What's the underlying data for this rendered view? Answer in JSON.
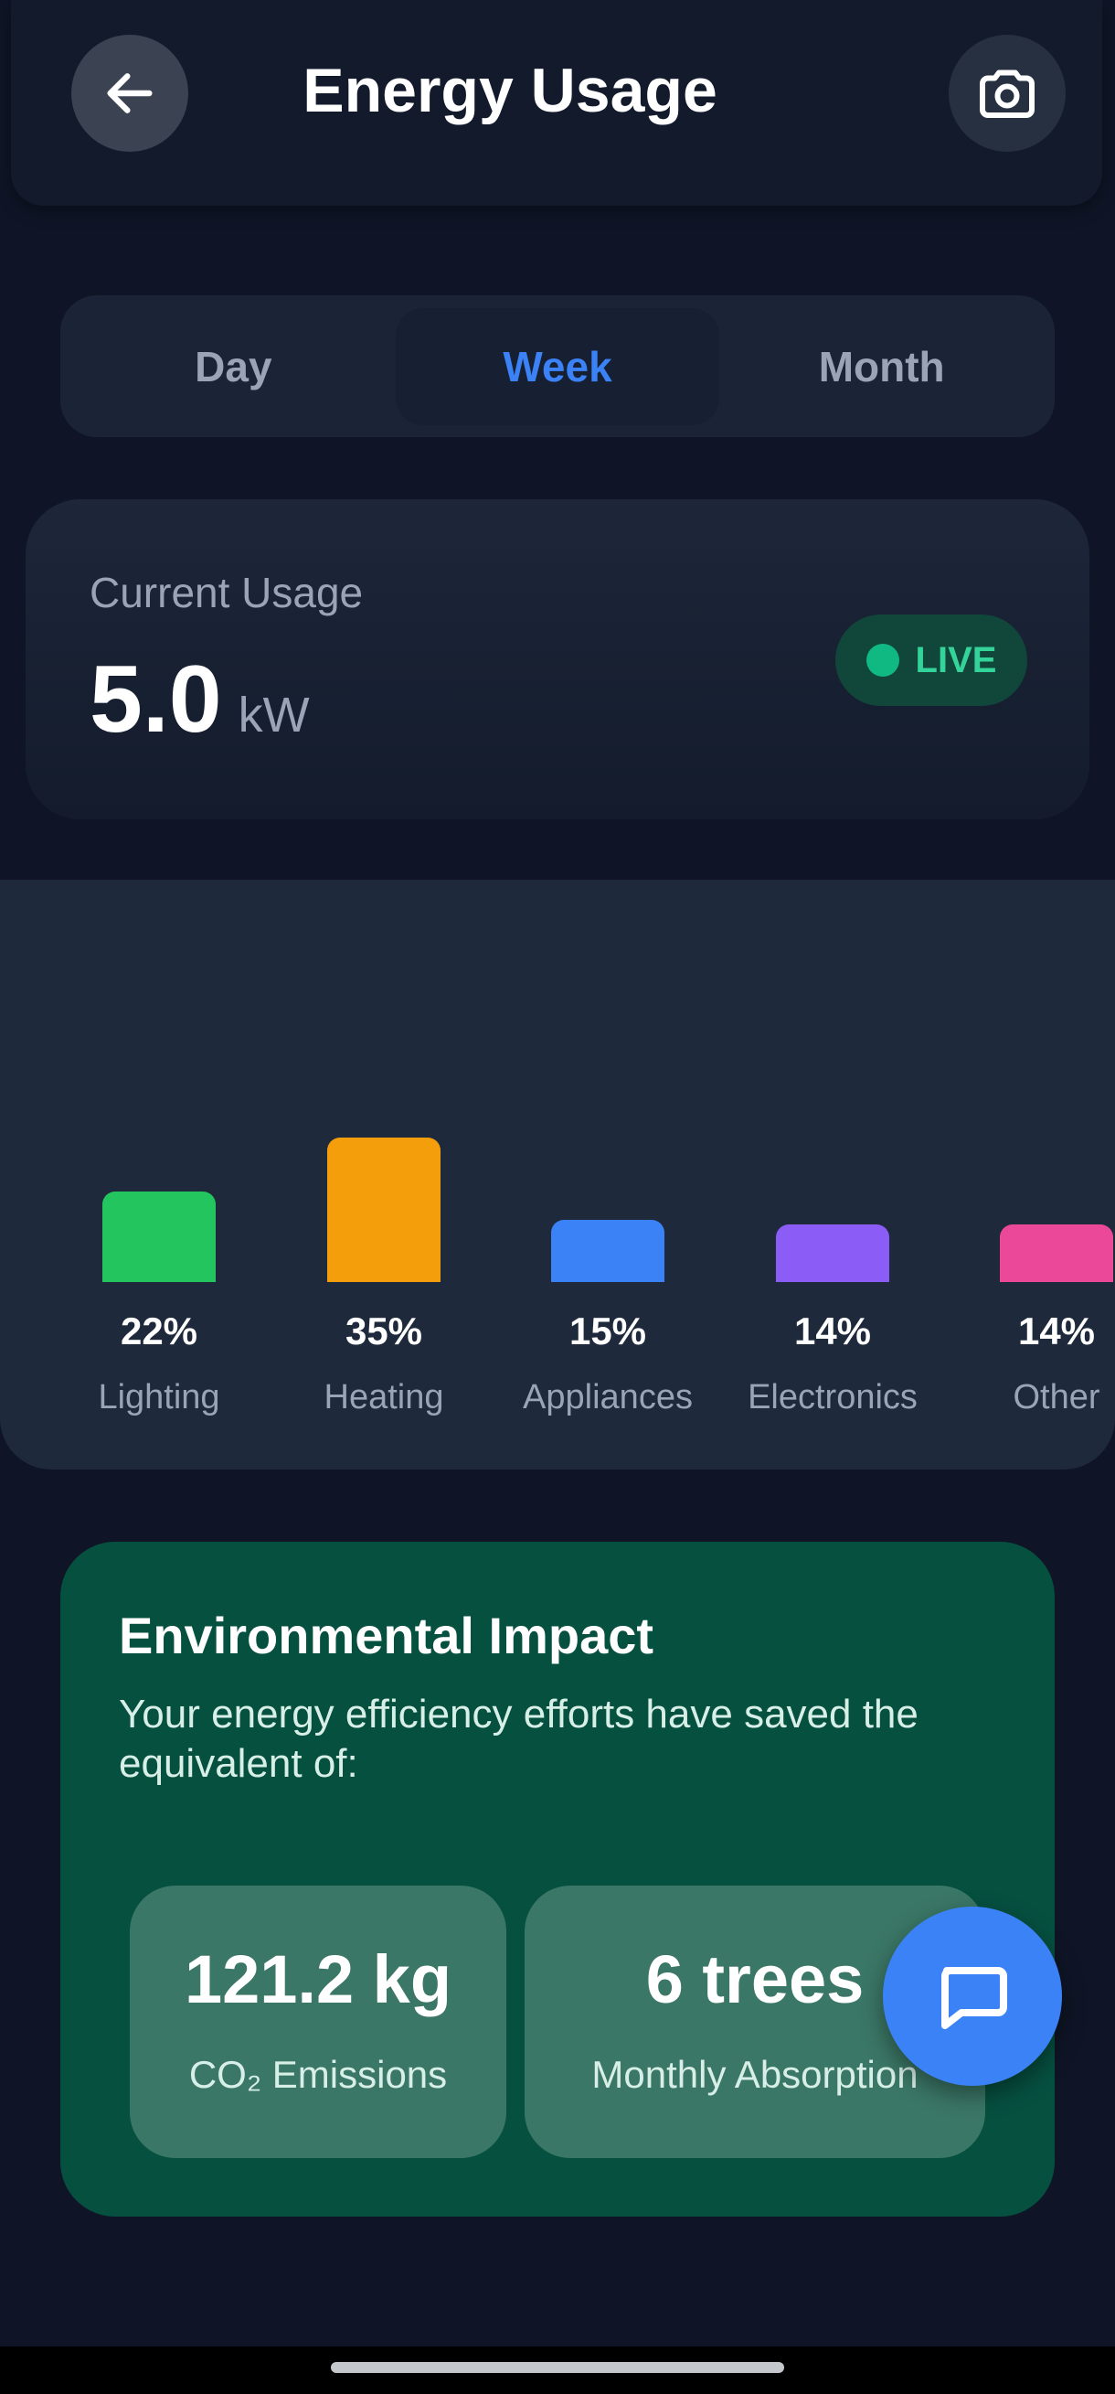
{
  "header": {
    "title": "Energy Usage",
    "back_icon": "arrow-left-icon",
    "camera_icon": "camera-icon"
  },
  "tabs": [
    {
      "label": "Day",
      "active": false
    },
    {
      "label": "Week",
      "active": true
    },
    {
      "label": "Month",
      "active": false
    }
  ],
  "usage": {
    "label": "Current Usage",
    "value": "5.0",
    "unit": "kW",
    "live_label": "LIVE"
  },
  "breakdown": {
    "items": [
      {
        "name": "Lighting",
        "percent_label": "22%",
        "percent": 22,
        "color": "#22c55e"
      },
      {
        "name": "Heating",
        "percent_label": "35%",
        "percent": 35,
        "color": "#f59e0b"
      },
      {
        "name": "Appliances",
        "percent_label": "15%",
        "percent": 15,
        "color": "#3b82f6"
      },
      {
        "name": "Electronics",
        "percent_label": "14%",
        "percent": 14,
        "color": "#8b5cf6"
      },
      {
        "name": "Other",
        "percent_label": "14%",
        "percent": 14,
        "color": "#ec4899"
      }
    ]
  },
  "environment": {
    "title": "Environmental Impact",
    "description": "Your energy efficiency efforts have saved the equivalent of:",
    "stats": [
      {
        "value": "121.2 kg",
        "label": "CO₂ Emissions"
      },
      {
        "value": "6 trees",
        "label": "Monthly Absorption"
      }
    ]
  },
  "fab": {
    "icon": "chat-icon"
  },
  "colors": {
    "accent": "#3b82f6",
    "live": "#34d399",
    "env_card": "#065040"
  }
}
